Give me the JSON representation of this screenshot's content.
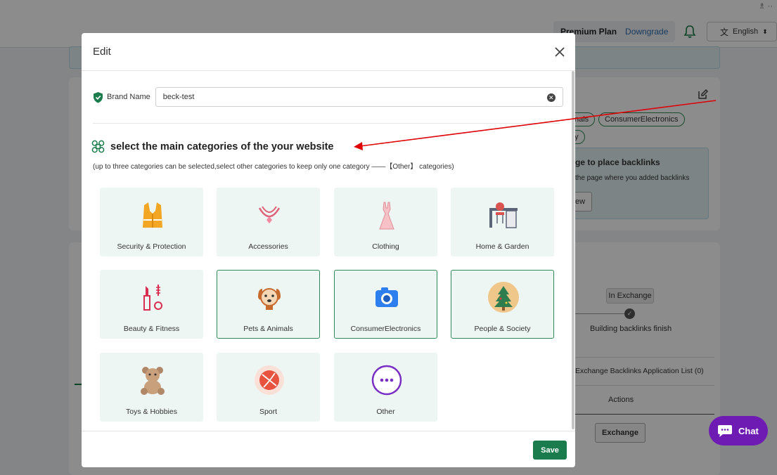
{
  "topbar": {
    "corner_glyph": "♗ ··"
  },
  "header": {
    "plan_name": "Premium Plan",
    "plan_action": "Downgrade",
    "language": "English"
  },
  "background": {
    "chip_1": "nals",
    "chip_2": "ConsumerElectronics",
    "chip_3": "y",
    "backlink_title": "ge to place backlinks",
    "backlink_desc": "the page where you added backlinks",
    "backlink_btn": "ew",
    "step_badge": "In Exchange",
    "step_label": "Building backlinks finish",
    "list_title": "Exchange Backlinks Application List (0)",
    "actions_header": "Actions",
    "exchange_btn": "Exchange"
  },
  "modal": {
    "title": "Edit",
    "brand_label": "Brand Name",
    "brand_value": "beck-test",
    "section_title": "select the main categories of the your website",
    "hint": "(up to three categories can be selected,select other categories to keep only one category ——【Other】 categories)",
    "save_label": "Save",
    "categories": [
      {
        "label": "Security & Protection",
        "icon": "vest-icon",
        "selected": false
      },
      {
        "label": "Accessories",
        "icon": "necklace-icon",
        "selected": false
      },
      {
        "label": "Clothing",
        "icon": "dress-icon",
        "selected": false
      },
      {
        "label": "Home & Garden",
        "icon": "desk-chair-icon",
        "selected": false
      },
      {
        "label": "Beauty & Fitness",
        "icon": "lipstick-icon",
        "selected": false
      },
      {
        "label": "Pets & Animals",
        "icon": "dog-icon",
        "selected": true
      },
      {
        "label": "ConsumerElectronics",
        "icon": "camera-icon",
        "selected": true
      },
      {
        "label": "People & Society",
        "icon": "tree-icon",
        "selected": true
      },
      {
        "label": "Toys & Hobbies",
        "icon": "teddy-bear-icon",
        "selected": false
      },
      {
        "label": "Sport",
        "icon": "ball-icon",
        "selected": false
      },
      {
        "label": "Other",
        "icon": "more-icon",
        "selected": false
      }
    ]
  },
  "chat": {
    "label": "Chat"
  },
  "colors": {
    "accent": "#1a7c4c",
    "tile_bg": "#eef6f3",
    "chat": "#6e1bb3",
    "arrow": "#e00000"
  }
}
